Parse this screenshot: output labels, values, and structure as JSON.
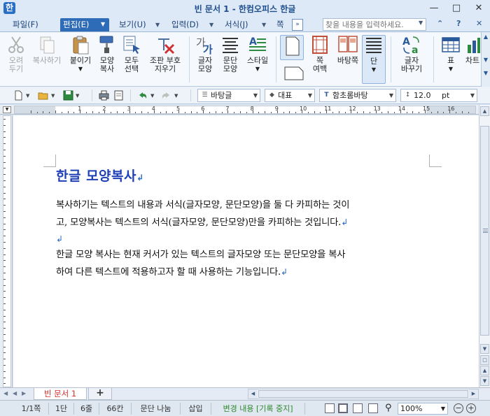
{
  "window": {
    "title": "빈 문서 1 - 한컴오피스 한글",
    "app_icon": "한"
  },
  "menu": {
    "items": [
      {
        "label": "파일(F)"
      },
      {
        "label": "편집(E)"
      },
      {
        "label": "보기(U)"
      },
      {
        "label": "입력(D)"
      },
      {
        "label": "서식(J)"
      },
      {
        "label": "쪽(W"
      }
    ],
    "search_placeholder": "찾을 내용을 입력하세요."
  },
  "ribbon": {
    "buttons": [
      {
        "label1": "오려",
        "label2": "두기",
        "icon": "scissors-icon",
        "disabled": true
      },
      {
        "label1": "복사하기",
        "label2": "",
        "icon": "copy-icon",
        "disabled": true
      },
      {
        "label1": "붙이기",
        "label2": "",
        "icon": "paste-icon",
        "disabled": false
      },
      {
        "label1": "모양",
        "label2": "복사",
        "icon": "format-painter-icon",
        "disabled": false
      },
      {
        "label1": "모두",
        "label2": "선택",
        "icon": "select-all-icon",
        "disabled": false
      },
      {
        "label1": "조판 부호",
        "label2": "지우기",
        "icon": "clear-codes-icon",
        "disabled": false
      },
      {
        "label1": "글자",
        "label2": "모양",
        "icon": "char-shape-icon",
        "disabled": false
      },
      {
        "label1": "문단",
        "label2": "모양",
        "icon": "para-shape-icon",
        "disabled": false
      },
      {
        "label1": "스타일",
        "label2": "",
        "icon": "style-icon",
        "disabled": false
      },
      {
        "label1": "쪽",
        "label2": "여백",
        "icon": "page-margin-icon",
        "disabled": false
      },
      {
        "label1": "바탕쪽",
        "label2": "",
        "icon": "master-page-icon",
        "disabled": false
      },
      {
        "label1": "단",
        "label2": "",
        "icon": "columns-icon",
        "disabled": false
      },
      {
        "label1": "글자",
        "label2": "바꾸기",
        "icon": "replace-char-icon",
        "disabled": false
      },
      {
        "label1": "표",
        "label2": "",
        "icon": "table-icon",
        "disabled": false
      },
      {
        "label1": "차트",
        "label2": "",
        "icon": "chart-icon",
        "disabled": false
      }
    ]
  },
  "toolbar": {
    "style_combo": "바탕글",
    "lang_combo": "대표",
    "font_combo": "함초롬바탕",
    "size_combo": "12.0",
    "unit_combo": "pt"
  },
  "ruler": {
    "numbers": [
      "1",
      "2",
      "3",
      "4",
      "5",
      "6",
      "7",
      "8",
      "9",
      "10",
      "11",
      "12",
      "13",
      "14",
      "15",
      "16"
    ]
  },
  "document": {
    "title": "한글 모양복사",
    "para1_line1": "복사하기는 텍스트의 내용과 서식(글자모양, 문단모양)을 둘 다 카피하는 것이",
    "para1_line2": "고, 모양복사는 텍스트의 서식(글자모양, 문단모양)만을 카피하는 것입니다.",
    "para2_line1": "한글 모양 복사는 현재 커서가 있는 텍스트의 글자모양 또는 문단모양을 복사",
    "para2_line2": "하여 다른 텍스트에 적용하고자 할 때 사용하는 기능입니다.",
    "para_mark": "↲"
  },
  "tabs": {
    "doc_tab": "빈 문서 1",
    "add_tab": "+"
  },
  "status": {
    "page": "1/1쪽",
    "column": "1단",
    "line": "6줄",
    "col": "66칸",
    "para_div": "문단 나눔",
    "insert": "삽입",
    "track": "변경 내용 [기록 중지]",
    "zoom": "100%"
  },
  "colors": {
    "accent": "#2f6cb7",
    "title_text": "#1f3fb5",
    "para_mark": "#2a68c8",
    "track_status": "#2e8a2e"
  }
}
